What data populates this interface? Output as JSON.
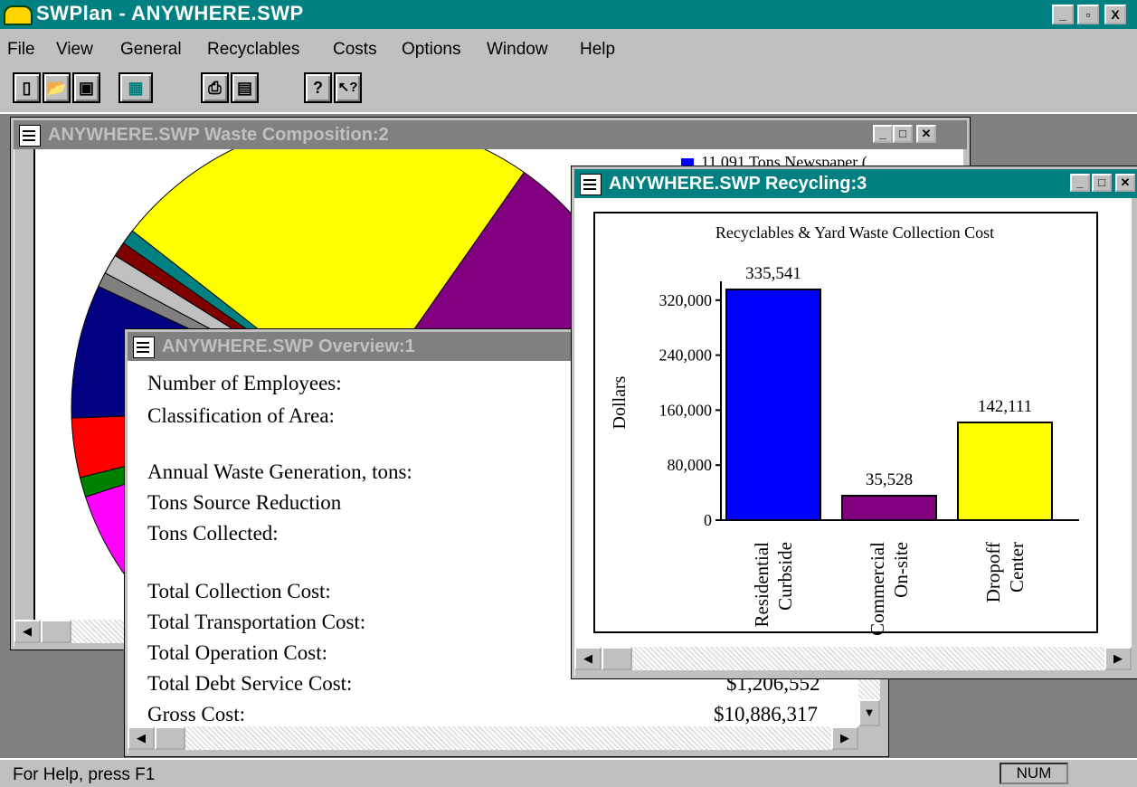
{
  "app": {
    "title": "SWPlan - ANYWHERE.SWP",
    "controls": [
      "_",
      "▫",
      "X"
    ]
  },
  "menu": [
    "File",
    "View",
    "General",
    "Recyclables",
    "Costs",
    "Options",
    "Window",
    "Help"
  ],
  "toolbar": {
    "buttons": [
      {
        "name": "new-icon",
        "glyph": "▯"
      },
      {
        "name": "open-icon",
        "glyph": "📂"
      },
      {
        "name": "save-icon",
        "glyph": "▣"
      },
      {
        "name": "calculator-icon",
        "glyph": "▦"
      },
      {
        "name": "print-icon",
        "glyph": "⎙"
      },
      {
        "name": "print-preview-icon",
        "glyph": "▤"
      },
      {
        "name": "help-icon",
        "glyph": "?"
      },
      {
        "name": "context-help-icon",
        "glyph": "↖?"
      }
    ]
  },
  "waste_window": {
    "title": "ANYWHERE.SWP Waste Composition:2",
    "legend_first": "11,091 Tons Newspaper (",
    "colors": [
      "#ffff00",
      "#800080",
      "#0000ff",
      "#ff00ff",
      "#008000",
      "#ff0000",
      "#000080",
      "#808080",
      "#c0c0c0",
      "#800000",
      "#008080"
    ]
  },
  "overview_window": {
    "title": "ANYWHERE.SWP Overview:1",
    "rows": [
      {
        "label": "Number of Employees:",
        "value": ""
      },
      {
        "label": "Classification of Area:",
        "value": ""
      },
      {
        "label": "Annual Waste Generation, tons:",
        "value": ""
      },
      {
        "label": "Tons Source Reduction",
        "value": ""
      },
      {
        "label": "Tons Collected:",
        "value": ""
      },
      {
        "label": "Total Collection Cost:",
        "value": ""
      },
      {
        "label": "Total Transportation Cost:",
        "value": ""
      },
      {
        "label": "Total Operation Cost:",
        "value": ""
      },
      {
        "label": "Total Debt Service Cost:",
        "value": "$1,206,552"
      },
      {
        "label": "Gross Cost:",
        "value": "$10,886,317"
      }
    ]
  },
  "recycling_window": {
    "title": "ANYWHERE.SWP Recycling:3"
  },
  "chart_data": {
    "type": "bar",
    "title": "Recyclables & Yard Waste Collection Cost",
    "ylabel": "Dollars",
    "ylim": [
      0,
      400000
    ],
    "yticks": [
      "0",
      "80,000",
      "160,000",
      "240,000",
      "320,000"
    ],
    "yticks_values": [
      0,
      80000,
      160000,
      240000,
      320000
    ],
    "categories": [
      {
        "line1": "Residential",
        "line2": "Curbside"
      },
      {
        "line1": "Commercial",
        "line2": "On-site"
      },
      {
        "line1": "Dropoff",
        "line2": "Center"
      }
    ],
    "values": [
      335541,
      35528,
      142111
    ],
    "value_labels": [
      "335,541",
      "35,528",
      "142,111"
    ],
    "colors": [
      "#0000ff",
      "#800080",
      "#ffff00"
    ]
  },
  "status": {
    "help": "For Help, press F1",
    "num": "NUM"
  }
}
